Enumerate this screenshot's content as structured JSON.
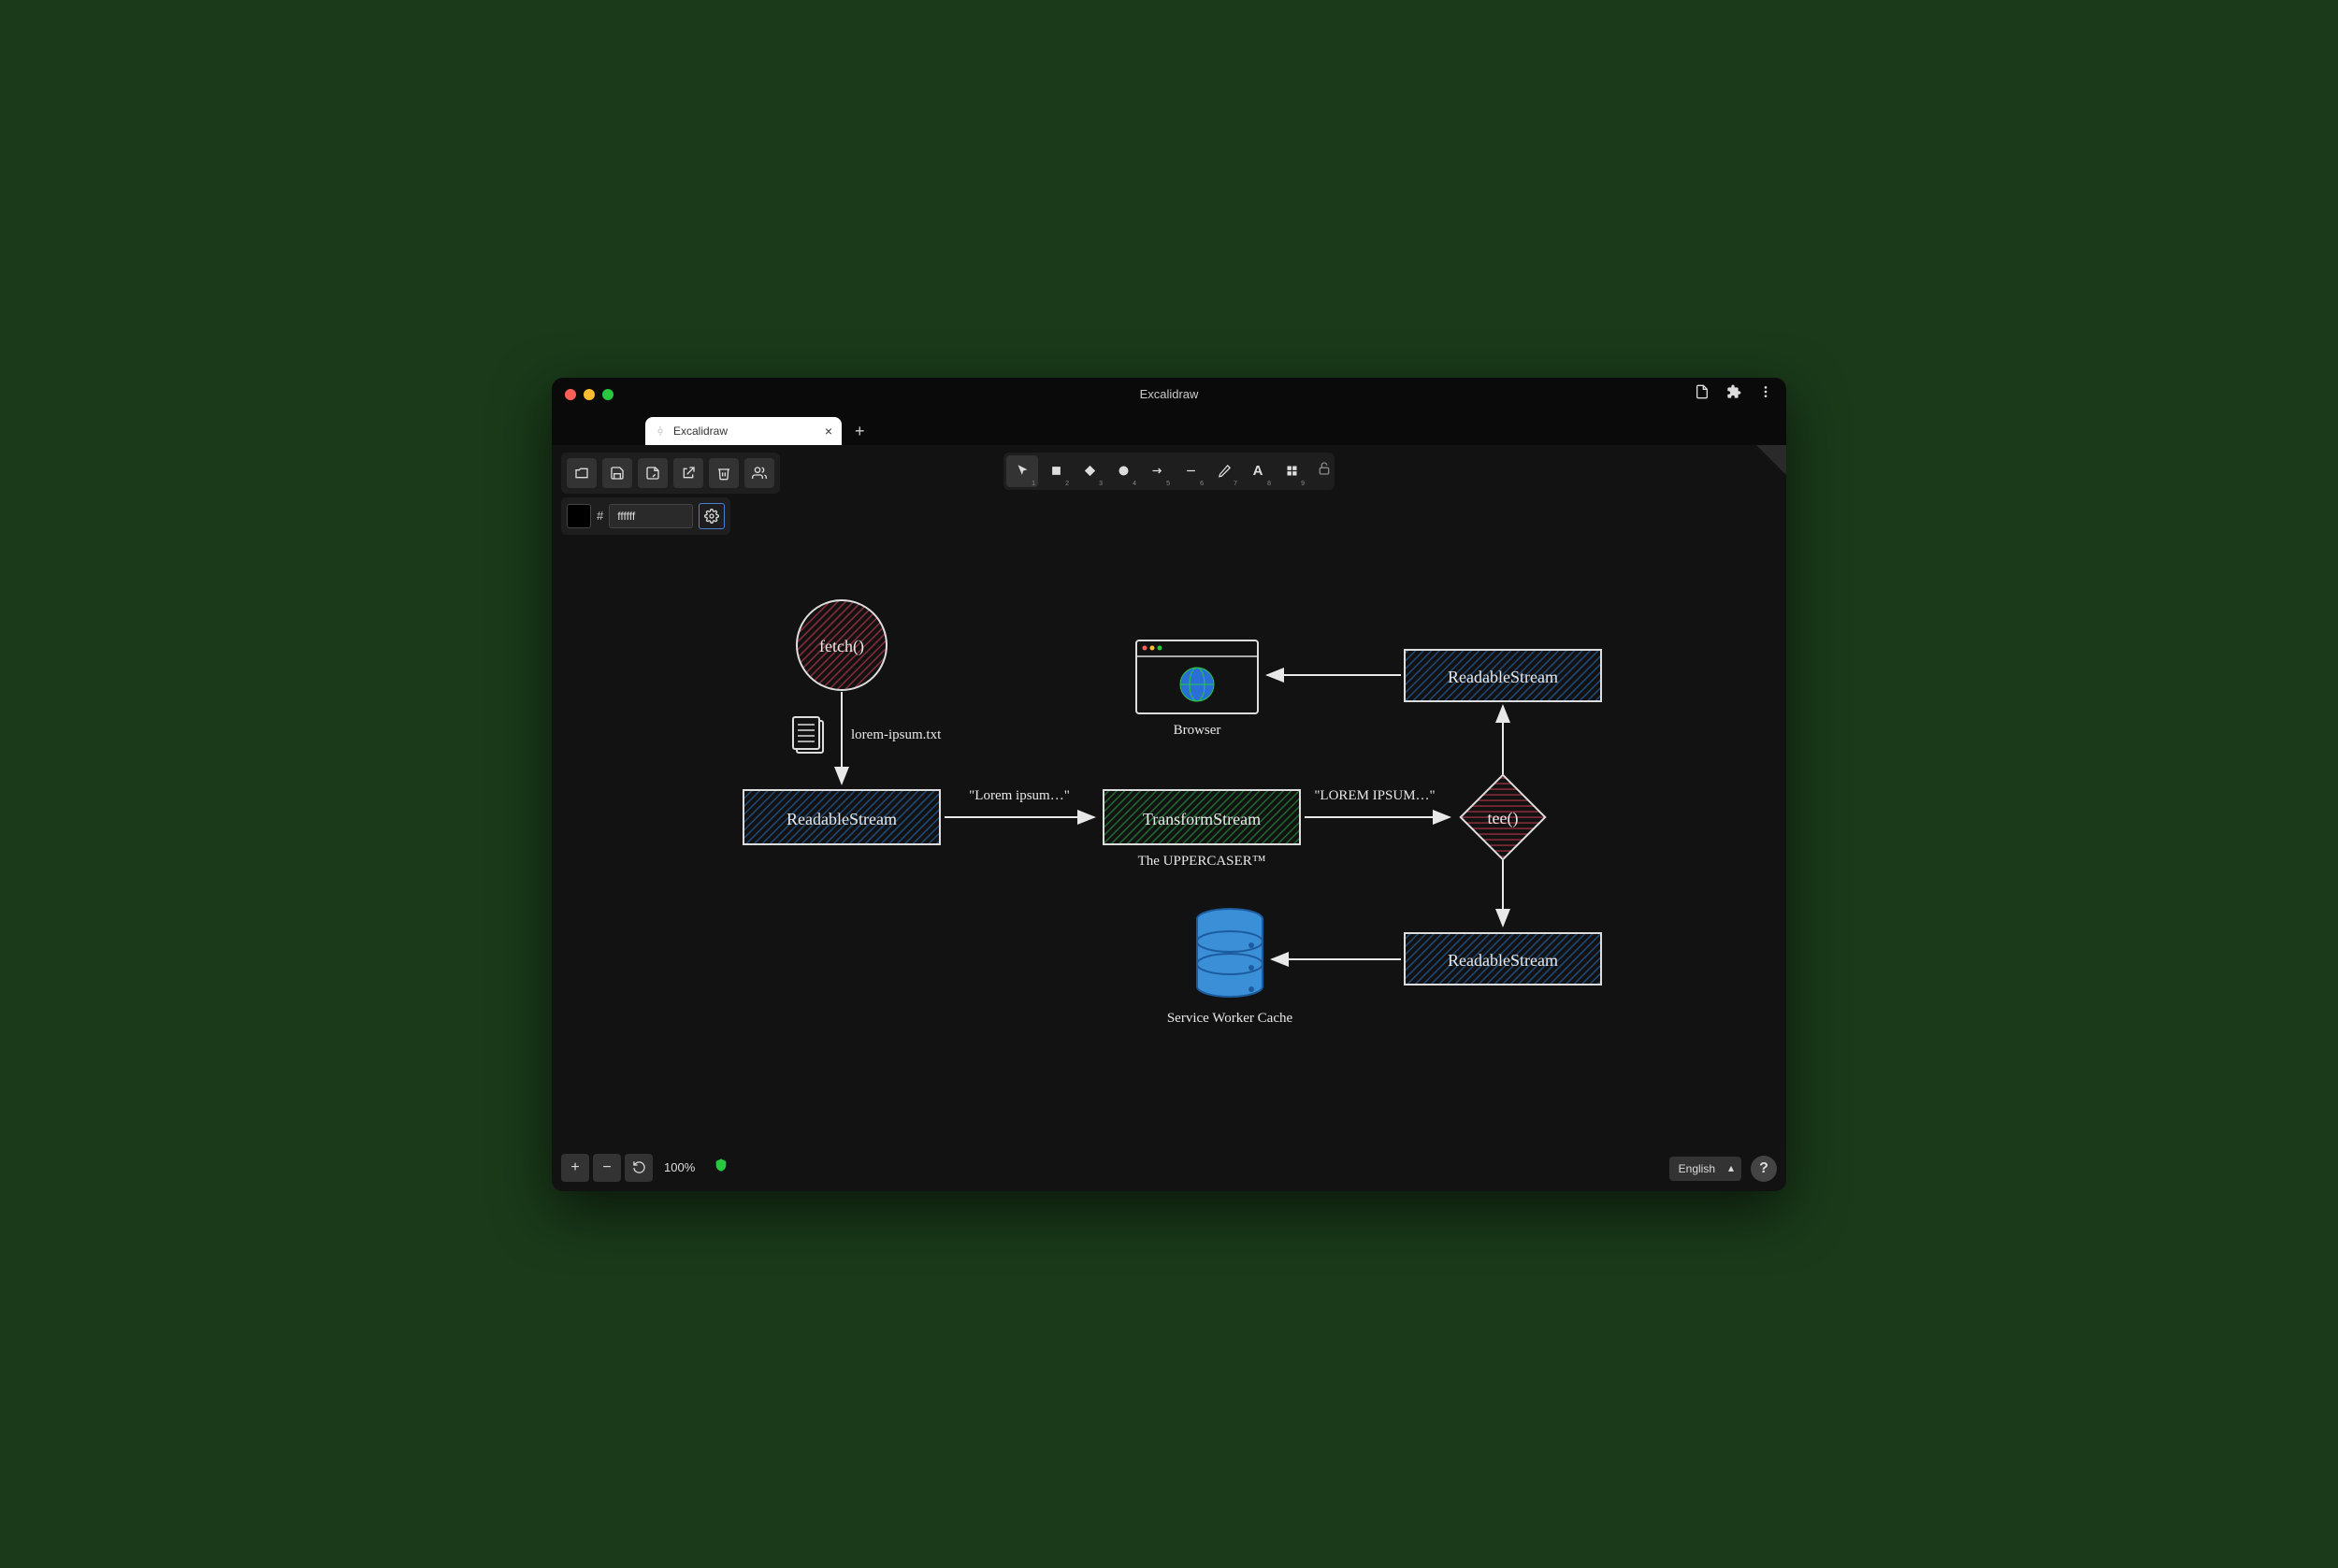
{
  "window": {
    "title": "Excalidraw"
  },
  "tab": {
    "title": "Excalidraw"
  },
  "color_input": {
    "hash": "#",
    "value": "ffffff"
  },
  "toolbar": {
    "tools": [
      {
        "name": "selection",
        "num": "1"
      },
      {
        "name": "rectangle",
        "num": "2"
      },
      {
        "name": "diamond",
        "num": "3"
      },
      {
        "name": "ellipse",
        "num": "4"
      },
      {
        "name": "arrow",
        "num": "5"
      },
      {
        "name": "line",
        "num": "6"
      },
      {
        "name": "draw",
        "num": "7"
      },
      {
        "name": "text",
        "num": "8"
      },
      {
        "name": "image",
        "num": "9"
      }
    ]
  },
  "zoom": {
    "pct": "100%"
  },
  "lang": {
    "selected": "English"
  },
  "diagram": {
    "fetch": "fetch()",
    "file_label": "lorem-ipsum.txt",
    "readable1": "ReadableStream",
    "arrow1": "\"Lorem ipsum…\"",
    "transform": "TransformStream",
    "transform_sub": "The UPPERCASER™",
    "arrow2": "\"LOREM IPSUM…\"",
    "tee": "tee()",
    "readable2": "ReadableStream",
    "readable3": "ReadableStream",
    "browser": "Browser",
    "cache": "Service Worker Cache"
  }
}
